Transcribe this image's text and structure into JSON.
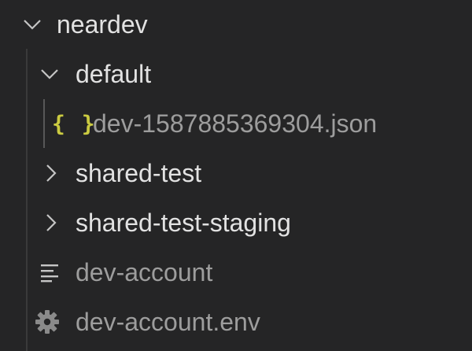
{
  "explorer": {
    "root": {
      "label": "neardev",
      "expanded": true,
      "icon": "chevron-down-icon"
    },
    "items": [
      {
        "label": "default",
        "type": "folder",
        "expanded": true,
        "icon": "chevron-down-icon"
      },
      {
        "label": "dev-1587885369304.json",
        "type": "file",
        "icon": "json-braces-icon",
        "icon_glyph": "{ }",
        "icon_color": "#cbcb41"
      },
      {
        "label": "shared-test",
        "type": "folder",
        "expanded": false,
        "icon": "chevron-right-icon"
      },
      {
        "label": "shared-test-staging",
        "type": "folder",
        "expanded": false,
        "icon": "chevron-right-icon"
      },
      {
        "label": "dev-account",
        "type": "file",
        "icon": "text-lines-icon"
      },
      {
        "label": "dev-account.env",
        "type": "file",
        "icon": "gear-icon"
      }
    ]
  },
  "colors": {
    "background": "#252526",
    "folder_text": "#e2e2e2",
    "file_text": "#9d9d9d",
    "json_icon": "#cbcb41",
    "indent_guide": "#3a3a3a"
  }
}
